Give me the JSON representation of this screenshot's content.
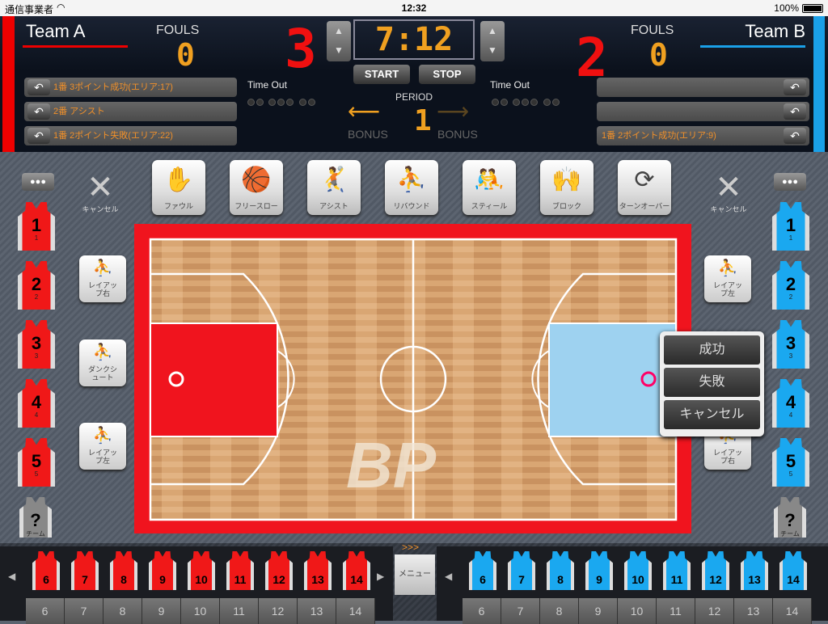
{
  "status": {
    "carrier": "通信事業者",
    "time": "12:32",
    "battery": "100%"
  },
  "teamA": {
    "name": "Team A",
    "fouls_label": "FOULS",
    "fouls": "0",
    "score": "3",
    "color": "#ee1111",
    "log": [
      "1番 3ポイント成功(エリア:17)",
      "2番 アシスト",
      "1番 2ポイント失敗(エリア:22)"
    ],
    "timeout_label": "Time Out",
    "bonus_label": "BONUS"
  },
  "teamB": {
    "name": "Team B",
    "fouls_label": "FOULS",
    "fouls": "0",
    "score": "2",
    "color": "#1aa0e8",
    "log": [
      "",
      "",
      "1番 2ポイント成功(エリア:9)"
    ],
    "timeout_label": "Time Out",
    "bonus_label": "BONUS"
  },
  "clock": {
    "time": "7:12",
    "start": "START",
    "stop": "STOP",
    "period_label": "PERIOD",
    "period": "1",
    "possession": "left"
  },
  "actions": [
    {
      "label": "ファウル",
      "icon": "foul-icon",
      "glyph": "✋"
    },
    {
      "label": "フリースロー",
      "icon": "free-throw-icon",
      "glyph": "🏀"
    },
    {
      "label": "アシスト",
      "icon": "assist-icon",
      "glyph": "🤾"
    },
    {
      "label": "リバウンド",
      "icon": "rebound-icon",
      "glyph": "⛹"
    },
    {
      "label": "スティール",
      "icon": "steal-icon",
      "glyph": "🤼"
    },
    {
      "label": "ブロック",
      "icon": "block-icon",
      "glyph": "🙌"
    },
    {
      "label": "ターンオーバー",
      "icon": "turnover-icon",
      "glyph": "⟳"
    }
  ],
  "cancel_label": "キャンセル",
  "shotsA": [
    "レイアップ右",
    "ダンクシュート",
    "レイアップ左"
  ],
  "shotsB": [
    "レイアップ左",
    "レイアップ右"
  ],
  "starters": [
    "1",
    "2",
    "3",
    "4",
    "5"
  ],
  "team_jersey_label": "チーム",
  "bench": [
    "6",
    "7",
    "8",
    "9",
    "10",
    "11",
    "12",
    "13",
    "14"
  ],
  "menu": {
    "label": "メニュー",
    "chevrons": ">>>"
  },
  "popup": {
    "made": "成功",
    "missed": "失敗",
    "cancel": "キャンセル"
  },
  "court_logo": "BP"
}
